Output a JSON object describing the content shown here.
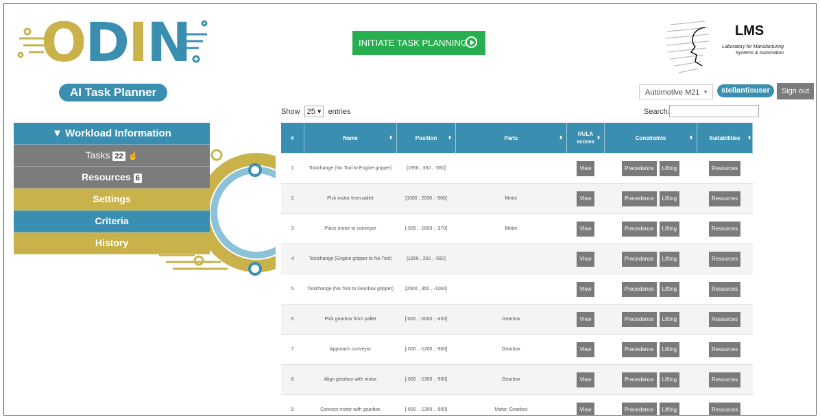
{
  "brand": {
    "logo_text": [
      "O",
      "D",
      "I",
      "N"
    ],
    "subtitle": "AI Task Planner",
    "colors": {
      "teal": "#3a8fb0",
      "gold": "#c9b24a",
      "gray": "#7c7c7c",
      "green": "#27ae4e"
    }
  },
  "initiate_button": {
    "label": "INITIATE TASK PLANNING",
    "icon": "play-circle-icon"
  },
  "lms": {
    "title": "LMS",
    "subtitle": "Laboratory for Manufacturing Systems & Automation"
  },
  "header": {
    "workspace": "Automotive M21",
    "user": "stellantisuser",
    "sign_out": "Sign out"
  },
  "table_controls": {
    "show": "Show",
    "page_length": "25",
    "entries": "entries",
    "search_label": "Search:",
    "search_value": ""
  },
  "sidebar": {
    "header": "▼ Workload Information",
    "items": [
      {
        "label": "Tasks",
        "badge": "22"
      },
      {
        "label": "Resources",
        "badge": "6"
      },
      {
        "label": "Settings"
      },
      {
        "label": "Criteria"
      },
      {
        "label": "History"
      }
    ]
  },
  "table": {
    "columns": [
      "#",
      "Name",
      "Position",
      "Parts",
      "RULA scores",
      "Constraints",
      "Suitabilities"
    ],
    "view_label": "View",
    "precedence_label": "Precedence",
    "lifting_label": "Lifting",
    "resources_label": "Resources",
    "rows": [
      {
        "n": "1",
        "name": "Toolchange (No Tool to Engine gripper)",
        "position": "[1950 , 350 , -550]",
        "parts": ""
      },
      {
        "n": "2",
        "name": "Pick motor from pallet",
        "position": "[1000 , 2000 , -500]",
        "parts": "Motor"
      },
      {
        "n": "3",
        "name": "Place motor to conveyor",
        "position": "[-505 , -1800 , -370]",
        "parts": "Motor"
      },
      {
        "n": "4",
        "name": "Toolchange (Engine gripper to No Tool)",
        "position": "[1950 , 350 , -550]",
        "parts": ""
      },
      {
        "n": "5",
        "name": "Toolchange (No Tool to Gearbox gripper)",
        "position": "[2500 , 350 , -1060]",
        "parts": ""
      },
      {
        "n": "6",
        "name": "Pick gearbox from pallet",
        "position": "[-600 , -2000 , -450]",
        "parts": "Gearbox"
      },
      {
        "n": "7",
        "name": "Approach conveyor",
        "position": "[-600 , -1200 , -900]",
        "parts": "Gearbox"
      },
      {
        "n": "8",
        "name": "Align gearbox with motor",
        "position": "[-600 , -1300 , -900]",
        "parts": "Gearbox"
      },
      {
        "n": "9",
        "name": "Connect motor with gearbox",
        "position": "[-600 , -1300 , -900]",
        "parts": "Motor, Gearbox"
      }
    ]
  }
}
